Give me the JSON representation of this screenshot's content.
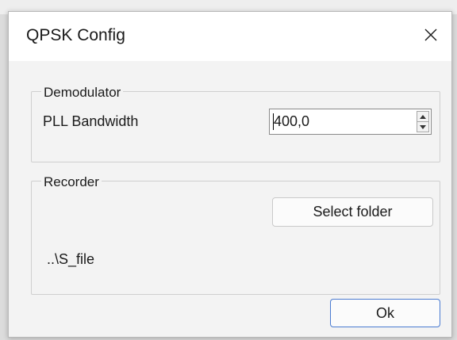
{
  "dialog": {
    "title": "QPSK Config",
    "close_label": "✕"
  },
  "demodulator": {
    "group_label": "Demodulator",
    "pll_label": "PLL Bandwidth",
    "pll_value": "400,0"
  },
  "recorder": {
    "group_label": "Recorder",
    "select_folder_label": "Select folder",
    "path_text": "..\\S_file"
  },
  "footer": {
    "ok_label": "Ok"
  },
  "colors": {
    "dialog_bg": "#f3f3f3",
    "title_bg": "#ffffff",
    "ok_border": "#4a7bd1"
  },
  "icons": [
    "close-icon",
    "spin-up-icon",
    "spin-down-icon"
  ]
}
